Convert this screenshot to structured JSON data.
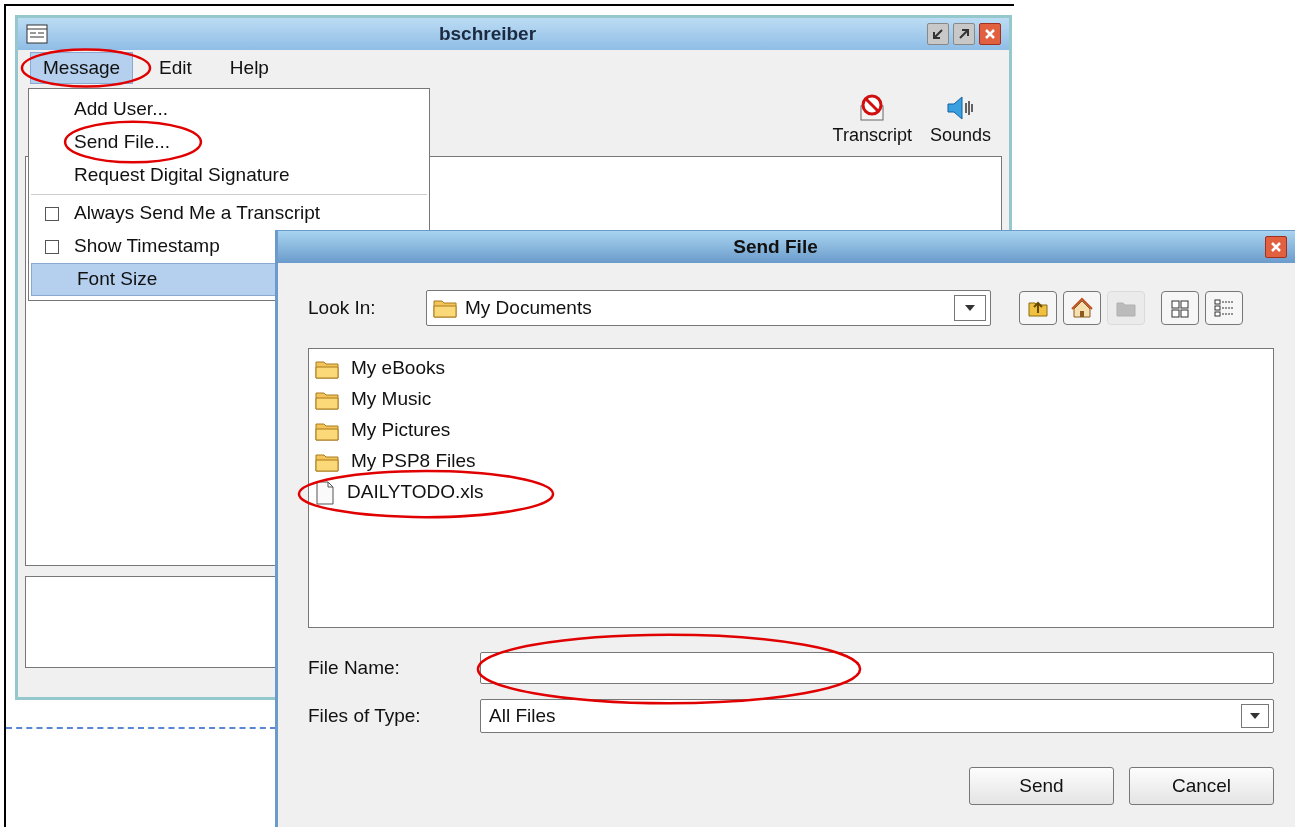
{
  "main_window": {
    "title": "bschreiber",
    "menu_bar": [
      {
        "label": "Message",
        "open": true,
        "circled": true
      },
      {
        "label": "Edit",
        "open": false,
        "circled": false
      },
      {
        "label": "Help",
        "open": false,
        "circled": false
      }
    ],
    "toolbar": [
      {
        "kind": "transcript",
        "label": "Transcript"
      },
      {
        "kind": "sounds",
        "label": "Sounds"
      }
    ]
  },
  "message_menu": {
    "items": [
      {
        "kind": "command",
        "label": "Add User...",
        "selected": false,
        "circled": false
      },
      {
        "kind": "command",
        "label": "Send File...",
        "selected": false,
        "circled": true
      },
      {
        "kind": "command",
        "label": "Request Digital Signature",
        "selected": false,
        "circled": false
      },
      {
        "kind": "separator"
      },
      {
        "kind": "checkbox",
        "label": "Always Send Me a Transcript",
        "checked": false,
        "selected": false,
        "circled": false
      },
      {
        "kind": "checkbox",
        "label": "Show Timestamp",
        "checked": false,
        "selected": false,
        "circled": false
      },
      {
        "kind": "command",
        "label": "Font Size",
        "selected": true,
        "circled": false
      }
    ]
  },
  "dialog": {
    "title": "Send File",
    "look_in": {
      "label": "Look In:",
      "value": "My Documents"
    },
    "toolbar": [
      {
        "kind": "up",
        "disabled": false
      },
      {
        "kind": "home",
        "disabled": false
      },
      {
        "kind": "new-folder",
        "disabled": true
      },
      {
        "kind": "list",
        "disabled": false
      },
      {
        "kind": "details",
        "disabled": false
      }
    ],
    "files": [
      {
        "kind": "folder",
        "name": "My eBooks",
        "circled": false
      },
      {
        "kind": "folder",
        "name": "My Music",
        "circled": false
      },
      {
        "kind": "folder",
        "name": "My Pictures",
        "circled": false
      },
      {
        "kind": "folder",
        "name": "My PSP8 Files",
        "circled": false
      },
      {
        "kind": "file",
        "name": "DAILYTODO.xls",
        "circled": true
      }
    ],
    "file_name": {
      "label": "File Name:",
      "circled": true
    },
    "file_type": {
      "label": "Files of Type:",
      "value": "All Files"
    },
    "buttons": [
      "Send",
      "Cancel"
    ]
  }
}
